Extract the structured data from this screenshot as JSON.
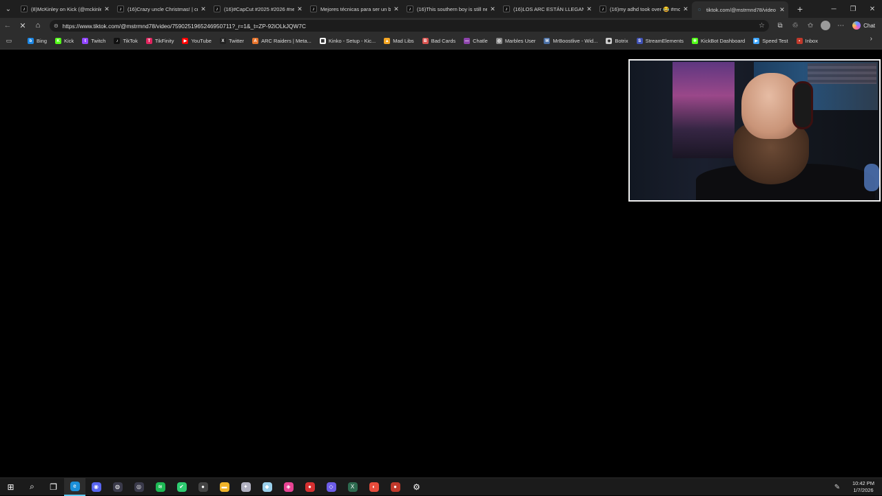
{
  "tabs": [
    {
      "title": "(8)McKinley on Kick (@mckinley",
      "icon": "tiktok-icon"
    },
    {
      "title": "(16)Crazy uncle Christmas! | cra",
      "icon": "tiktok-icon"
    },
    {
      "title": "(16)#CapCut #2025 #2026 #new",
      "icon": "tiktok-icon"
    },
    {
      "title": "Mejores técnicas para ser un bu",
      "icon": "tiktok-icon"
    },
    {
      "title": "(16)This southern boy is still ne",
      "icon": "tiktok-icon"
    },
    {
      "title": "(16)LOS ARC ESTÁN LLEGANDO",
      "icon": "tiktok-icon"
    },
    {
      "title": "(16)my adhd took over 😂 #mc",
      "icon": "tiktok-icon"
    },
    {
      "title": "tiktok.com/@mstrmnd78/video",
      "icon": "loading-icon",
      "active": true
    }
  ],
  "address": {
    "url": "https://www.tiktok.com/@mstrmnd78/video/7590251965246950711?_r=1&_t=ZP-92iOLkJQW7C"
  },
  "toolbar": {
    "chat_label": "Chat"
  },
  "bookmarks": [
    {
      "label": "Bing",
      "color": "#1e88e5",
      "glyph": "b"
    },
    {
      "label": "Kick",
      "color": "#53fc18",
      "glyph": "K"
    },
    {
      "label": "Twitch",
      "color": "#9146ff",
      "glyph": "t"
    },
    {
      "label": "TikTok",
      "color": "#111111",
      "glyph": "♪"
    },
    {
      "label": "TikFinity",
      "color": "#e0245e",
      "glyph": "T"
    },
    {
      "label": "YouTube",
      "color": "#ff0000",
      "glyph": "▶"
    },
    {
      "label": "Twitter",
      "color": "#222222",
      "glyph": "X"
    },
    {
      "label": "ARC Raiders | Meta...",
      "color": "#e8742c",
      "glyph": "A"
    },
    {
      "label": "Kinko - Setup - Kic...",
      "color": "#ffffff",
      "glyph": "▦"
    },
    {
      "label": "Mad Libs",
      "color": "#f5a623",
      "glyph": "▲"
    },
    {
      "label": "Bad Cards",
      "color": "#d9534f",
      "glyph": "B"
    },
    {
      "label": "Chatle",
      "color": "#8e44ad",
      "glyph": "—"
    },
    {
      "label": "Marbles User",
      "color": "#888888",
      "glyph": "◎"
    },
    {
      "label": "MrBoostlive - Wid...",
      "color": "#4a6fa5",
      "glyph": "M"
    },
    {
      "label": "Botrix",
      "color": "#cccccc",
      "glyph": "◆"
    },
    {
      "label": "StreamElements",
      "color": "#3f51b5",
      "glyph": "S"
    },
    {
      "label": "KickBot Dashboard",
      "color": "#53fc18",
      "glyph": "✲"
    },
    {
      "label": "Speed Test",
      "color": "#3ea6ff",
      "glyph": "▶"
    },
    {
      "label": "Inbox",
      "color": "#c0392b",
      "glyph": "▪"
    }
  ],
  "taskbar": {
    "apps": [
      {
        "name": "windows-start-icon",
        "color": "#2b2b2b",
        "glyph": "⊞"
      },
      {
        "name": "search-icon",
        "color": "#2b2b2b",
        "glyph": "⌕"
      },
      {
        "name": "task-view-icon",
        "color": "#2b2b2b",
        "glyph": "❐"
      },
      {
        "name": "edge-browser-icon",
        "color": "#1b8fd8",
        "glyph": "e",
        "active": true
      },
      {
        "name": "discord-icon",
        "color": "#5865f2",
        "glyph": "◉"
      },
      {
        "name": "app-icon-1",
        "color": "#3a3a4a",
        "glyph": "◍"
      },
      {
        "name": "app-icon-2",
        "color": "#3a3a4a",
        "glyph": "◎"
      },
      {
        "name": "spotify-icon",
        "color": "#1db954",
        "glyph": "≋"
      },
      {
        "name": "app-icon-3",
        "color": "#2ecc71",
        "glyph": "✔"
      },
      {
        "name": "obs-icon",
        "color": "#444444",
        "glyph": "●"
      },
      {
        "name": "file-explorer-icon",
        "color": "#f0b429",
        "glyph": "▬"
      },
      {
        "name": "app-icon-4",
        "color": "#b0b0c0",
        "glyph": "✦"
      },
      {
        "name": "app-icon-5",
        "color": "#9ad0ec",
        "glyph": "◆"
      },
      {
        "name": "app-icon-6",
        "color": "#e84393",
        "glyph": "◈"
      },
      {
        "name": "app-icon-7",
        "color": "#d63031",
        "glyph": "●"
      },
      {
        "name": "app-icon-8",
        "color": "#6c5ce7",
        "glyph": "◇"
      },
      {
        "name": "app-icon-9",
        "color": "#2d6a4f",
        "glyph": "X"
      },
      {
        "name": "app-icon-10",
        "color": "#e74c3c",
        "glyph": "◐"
      },
      {
        "name": "app-icon-11",
        "color": "#c0392b",
        "glyph": "●"
      },
      {
        "name": "settings-icon",
        "color": "#2b2b2b",
        "glyph": "⚙"
      }
    ],
    "time": "10:42 PM",
    "date": "1/7/2026"
  }
}
